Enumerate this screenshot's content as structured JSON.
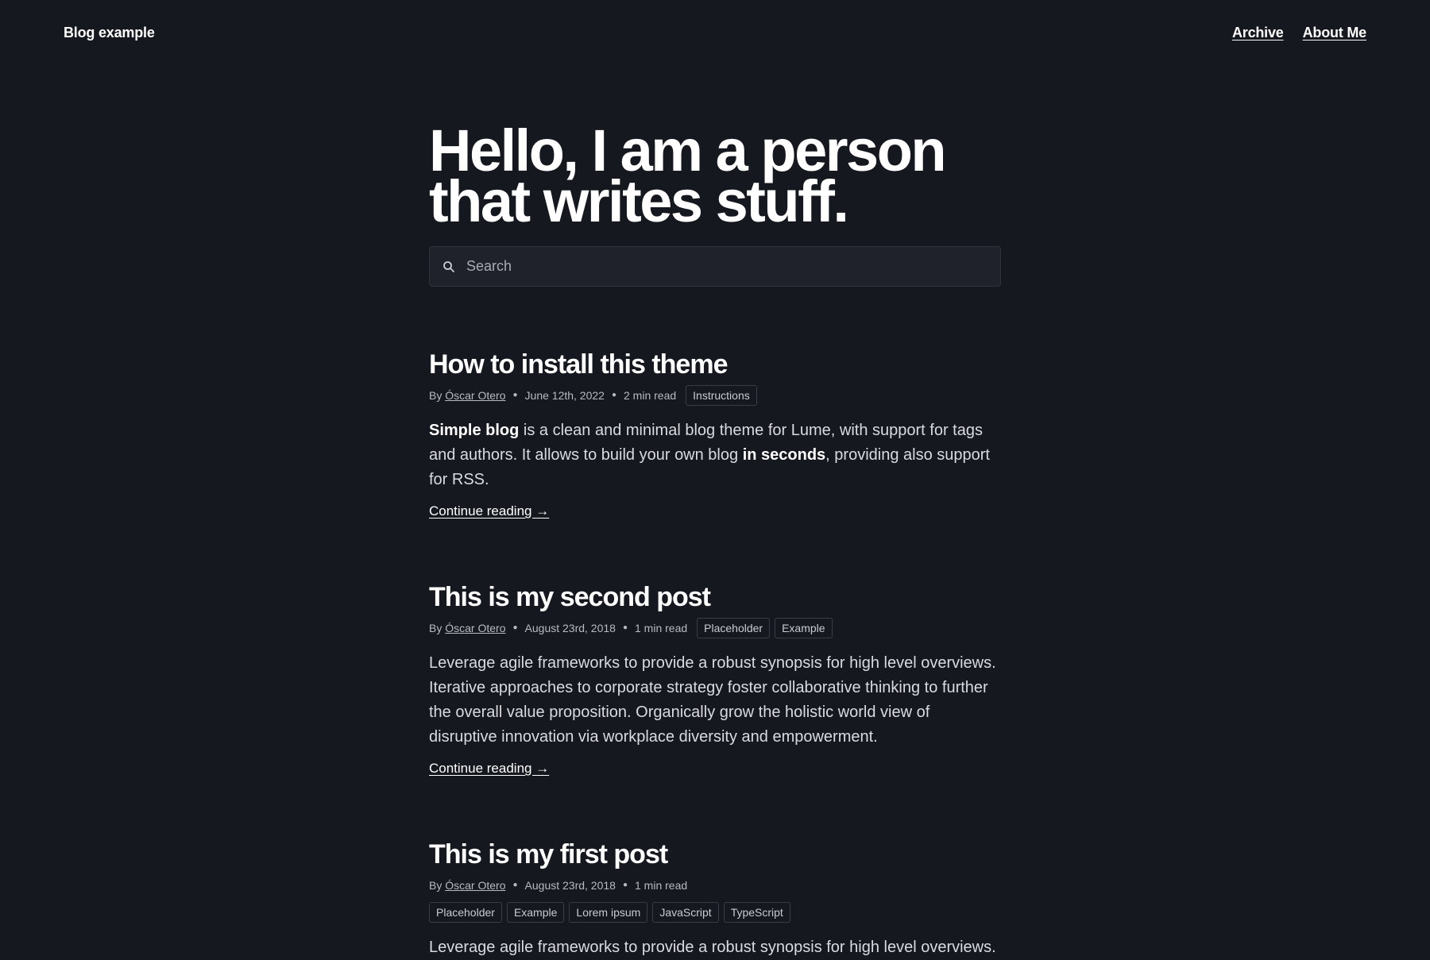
{
  "header": {
    "brand": "Blog example",
    "nav": [
      {
        "label": "Archive"
      },
      {
        "label": "About Me"
      }
    ]
  },
  "hero": {
    "line1": "Hello, I am a person",
    "line2": "that writes stuff."
  },
  "search": {
    "placeholder": "Search",
    "icon": "search-icon"
  },
  "posts": [
    {
      "title": "How to install this theme",
      "by": "By",
      "author": "Óscar Otero",
      "date": "June 12th, 2022",
      "read_time": "2 min read",
      "tags": [
        "Instructions"
      ],
      "excerpt_parts": {
        "b1": "Simple blog",
        "t1": " is a clean and minimal blog theme for Lume, with support for tags and authors. It allows to build your own blog ",
        "b2": "in seconds",
        "t2": ", providing also support for RSS."
      },
      "continue": "Continue reading →"
    },
    {
      "title": "This is my second post",
      "by": "By",
      "author": "Óscar Otero",
      "date": "August 23rd, 2018",
      "read_time": "1 min read",
      "tags": [
        "Placeholder",
        "Example"
      ],
      "excerpt": "Leverage agile frameworks to provide a robust synopsis for high level overviews. Iterative approaches to corporate strategy foster collaborative thinking to further the overall value proposition. Organically grow the holistic world view of disruptive innovation via workplace diversity and empowerment.",
      "continue": "Continue reading →"
    },
    {
      "title": "This is my first post",
      "by": "By",
      "author": "Óscar Otero",
      "date": "August 23rd, 2018",
      "read_time": "1 min read",
      "tags": [
        "Placeholder",
        "Example",
        "Lorem ipsum",
        "JavaScript",
        "TypeScript"
      ],
      "excerpt": "Leverage agile frameworks to provide a robust synopsis for high level overviews."
    }
  ],
  "colors": {
    "background": "#16181f",
    "text": "#e6e7ea",
    "heading": "#ffffff",
    "search_bg": "#1f222b",
    "tag_border": "#3a3d48"
  }
}
